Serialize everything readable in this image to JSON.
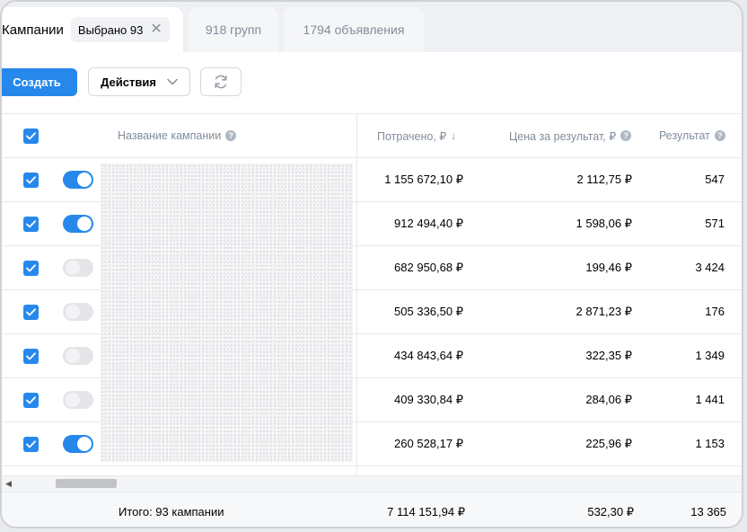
{
  "tabs": {
    "campaigns_label": "Кампании",
    "selected_chip": "Выбрано 93",
    "groups_label": "918 групп",
    "ads_label": "1794 объявления"
  },
  "toolbar": {
    "create_label": "Создать",
    "actions_label": "Действия"
  },
  "table": {
    "headers": {
      "name": "Название кампании",
      "spent": "Потрачено, ₽",
      "price": "Цена за результат, ₽",
      "result": "Результат"
    },
    "rows": [
      {
        "enabled": true,
        "spent": "1 155 672,10 ₽",
        "price": "2 112,75 ₽",
        "result": "547"
      },
      {
        "enabled": true,
        "spent": "912 494,40 ₽",
        "price": "1 598,06 ₽",
        "result": "571"
      },
      {
        "enabled": false,
        "spent": "682 950,68 ₽",
        "price": "199,46 ₽",
        "result": "3 424"
      },
      {
        "enabled": false,
        "spent": "505 336,50 ₽",
        "price": "2 871,23 ₽",
        "result": "176"
      },
      {
        "enabled": false,
        "spent": "434 843,64 ₽",
        "price": "322,35 ₽",
        "result": "1 349"
      },
      {
        "enabled": false,
        "spent": "409 330,84 ₽",
        "price": "284,06 ₽",
        "result": "1 441"
      },
      {
        "enabled": true,
        "spent": "260 528,17 ₽",
        "price": "225,96 ₽",
        "result": "1 153"
      }
    ],
    "footer": {
      "total_label": "Итого: 93 кампании",
      "spent": "7 114 151,94 ₽",
      "price": "532,30 ₽",
      "result": "13 365"
    }
  },
  "colors": {
    "accent": "#2688eb",
    "muted_text": "#818c99",
    "toggle_off": "#e3e5e8"
  },
  "icons": [
    "close-icon",
    "chevron-down-icon",
    "refresh-icon",
    "help-icon",
    "sort-down-icon",
    "checkmark-icon"
  ]
}
